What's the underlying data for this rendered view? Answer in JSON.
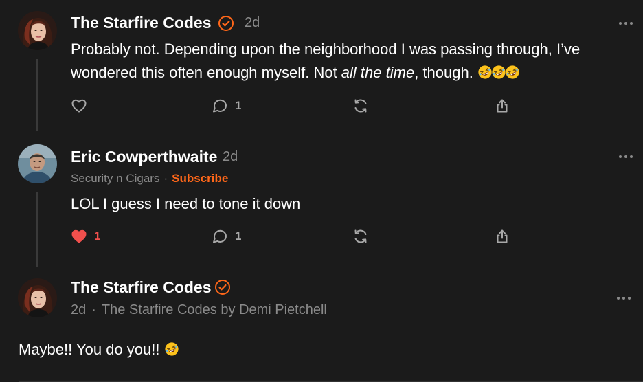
{
  "comments": [
    {
      "author": "The Starfire Codes",
      "time": "2d",
      "verified": true,
      "body_line1": "Probably not. Depending upon the neighborhood I was passing through, I’ve",
      "body_line2_a": "wondered this often enough myself. Not ",
      "body_line2_em": "all the time",
      "body_line2_b": ", though.",
      "emoji": "rolling-on-floor-laughing-emoji x3",
      "likes": "",
      "replies": "1",
      "liked": false
    },
    {
      "author": "Eric Cowperthwaite",
      "time": "2d",
      "publication": "Security n Cigars",
      "subscribe_label": "Subscribe",
      "body": "LOL I guess I need to tone it down",
      "likes": "1",
      "replies": "1",
      "liked": true
    },
    {
      "author": "The Starfire Codes",
      "time": "2d",
      "verified": true,
      "publication": "The Starfire Codes by Demi Pietchell",
      "body": "Maybe!! You do you!!",
      "emoji": "rolling-on-floor-laughing-emoji"
    }
  ],
  "separator": "·",
  "colors": {
    "background": "#1b1b1b",
    "accent": "#ff6719",
    "like_red": "#f0504d",
    "muted": "#8a8a8a"
  }
}
